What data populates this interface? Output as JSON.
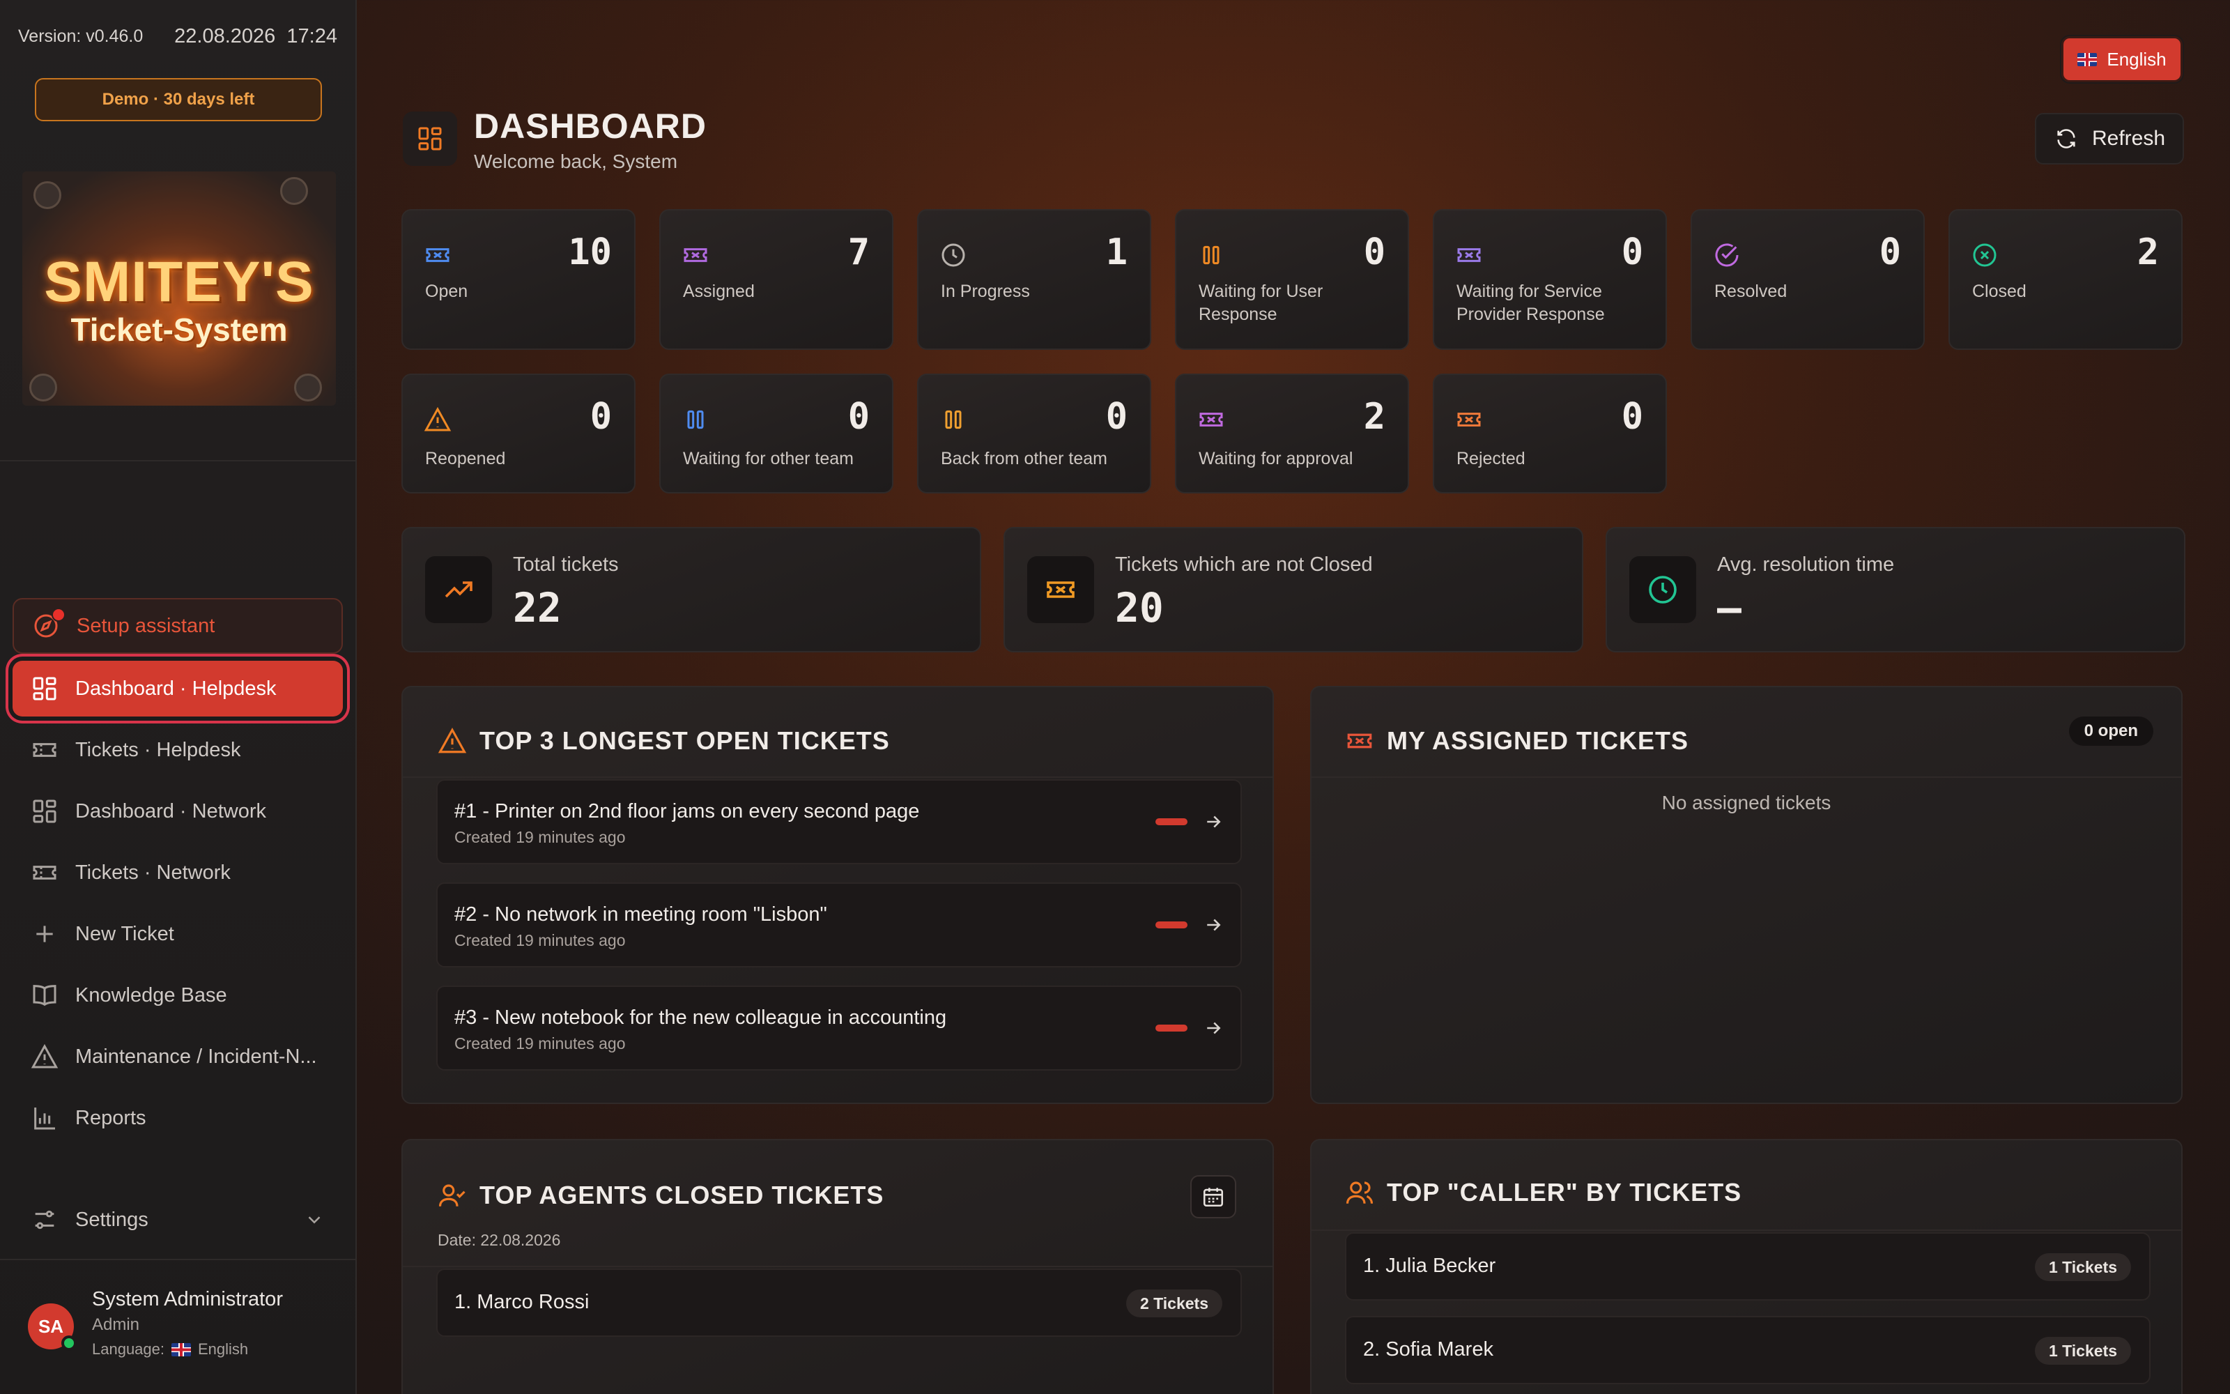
{
  "sidebar": {
    "version": "Version: v0.46.0",
    "date": "22.08.2026",
    "time": "17:24",
    "demo_badge": "Demo · 30 days left",
    "logo_line1": "SMITEY'S",
    "logo_line2": "Ticket-System",
    "setup_assistant": "Setup assistant",
    "nav": [
      {
        "label": "Dashboard · Helpdesk",
        "icon": "dashboard-icon",
        "active": true
      },
      {
        "label": "Tickets · Helpdesk",
        "icon": "ticket-icon"
      },
      {
        "label": "Dashboard · Network",
        "icon": "dashboard-icon"
      },
      {
        "label": "Tickets · Network",
        "icon": "ticket-icon"
      },
      {
        "label": "New Ticket",
        "icon": "plus-icon"
      },
      {
        "label": "Knowledge Base",
        "icon": "book-icon"
      },
      {
        "label": "Maintenance / Incident-N...",
        "icon": "warning-icon"
      },
      {
        "label": "Reports",
        "icon": "bar-chart-icon"
      }
    ],
    "settings": "Settings",
    "user": {
      "initials": "SA",
      "name": "System Administrator",
      "role": "Admin",
      "language_label": "Language:",
      "language": "English"
    }
  },
  "header": {
    "language_button": "English",
    "title": "DASHBOARD",
    "subtitle": "Welcome back, System",
    "refresh": "Refresh"
  },
  "stats": [
    {
      "label": "Open",
      "value": "10",
      "icon": "ticket-icon",
      "color": "#4f8cf0"
    },
    {
      "label": "Assigned",
      "value": "7",
      "icon": "ticket-icon",
      "color": "#b06ae0"
    },
    {
      "label": "In Progress",
      "value": "1",
      "icon": "clock-icon",
      "color": "#b8b2ad"
    },
    {
      "label": "Waiting for User Response",
      "value": "0",
      "icon": "pause-icon",
      "color": "#f08a24"
    },
    {
      "label": "Waiting for Service Provider Response",
      "value": "0",
      "icon": "ticket-icon",
      "color": "#9a7ae8"
    },
    {
      "label": "Resolved",
      "value": "0",
      "icon": "check-circle-icon",
      "color": "#c06ae0"
    },
    {
      "label": "Closed",
      "value": "2",
      "icon": "x-circle-icon",
      "color": "#22c593"
    },
    {
      "label": "Reopened",
      "value": "0",
      "icon": "warning-icon",
      "color": "#f08a24"
    },
    {
      "label": "Waiting for other team",
      "value": "0",
      "icon": "pause-icon",
      "color": "#4f8cf0"
    },
    {
      "label": "Back from other team",
      "value": "0",
      "icon": "pause-icon",
      "color": "#f0a030"
    },
    {
      "label": "Waiting for approval",
      "value": "2",
      "icon": "ticket-icon",
      "color": "#c06ae0"
    },
    {
      "label": "Rejected",
      "value": "0",
      "icon": "ticket-icon",
      "color": "#f07a3a"
    }
  ],
  "summary": [
    {
      "label": "Total tickets",
      "value": "22",
      "icon": "trending-up-icon",
      "color": "#f07a24"
    },
    {
      "label": "Tickets which are not Closed",
      "value": "20",
      "icon": "ticket-icon",
      "color": "#f09a24"
    },
    {
      "label": "Avg. resolution time",
      "value": "—",
      "icon": "clock-icon",
      "color": "#22c593"
    }
  ],
  "longest_open": {
    "title": "TOP 3 LONGEST OPEN TICKETS",
    "tickets": [
      {
        "title": "#1 - Printer on 2nd floor jams on every second page",
        "created": "Created 19 minutes ago"
      },
      {
        "title": "#2 - No network in meeting room \"Lisbon\"",
        "created": "Created 19 minutes ago"
      },
      {
        "title": "#3 - New notebook for the new colleague in accounting",
        "created": "Created 19 minutes ago"
      }
    ]
  },
  "my_assigned": {
    "title": "MY ASSIGNED TICKETS",
    "badge": "0 open",
    "empty": "No assigned tickets"
  },
  "top_agents": {
    "title": "TOP AGENTS CLOSED TICKETS",
    "date": "Date: 22.08.2026",
    "rows": [
      {
        "name": "1. Marco Rossi",
        "count": "2 Tickets"
      }
    ]
  },
  "top_callers": {
    "title": "TOP \"CALLER\" BY TICKETS",
    "rows": [
      {
        "name": "1. Julia Becker",
        "count": "1 Tickets"
      },
      {
        "name": "2. Sofia Marek",
        "count": "1 Tickets"
      }
    ]
  },
  "colors": {
    "accent": "#d23a2e",
    "orange": "#f07a24"
  }
}
